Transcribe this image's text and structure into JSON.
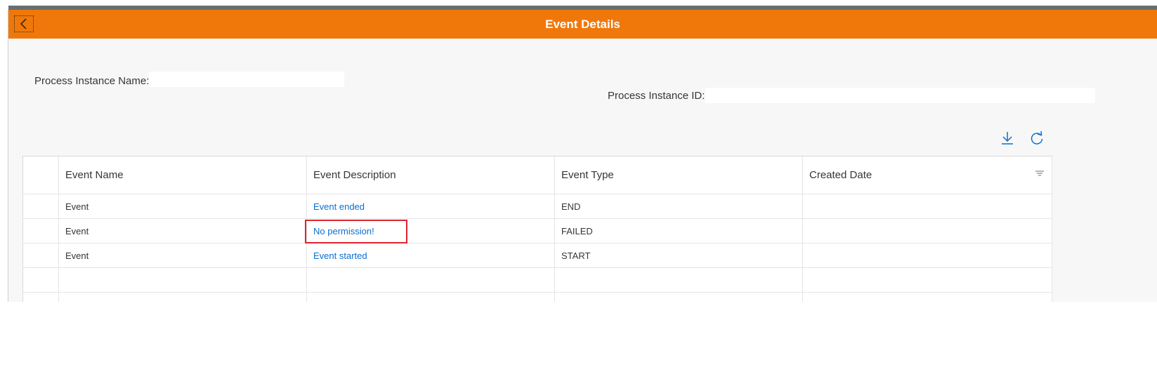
{
  "header": {
    "title": "Event Details",
    "back_icon": "chevron-left-icon"
  },
  "fields": {
    "instance_name_label": "Process Instance Name:",
    "instance_name_value": "",
    "instance_id_label": "Process Instance ID:",
    "instance_id_value": ""
  },
  "toolbar": {
    "download_icon": "download-icon",
    "refresh_icon": "refresh-icon"
  },
  "table": {
    "columns": [
      "Event Name",
      "Event Description",
      "Event Type",
      "Created Date"
    ],
    "rows": [
      {
        "name": "Event",
        "description": "Event ended",
        "type": "END",
        "created": ""
      },
      {
        "name": "Event",
        "description": "No permission!",
        "type": "FAILED",
        "created": ""
      },
      {
        "name": "Event",
        "description": "Event started",
        "type": "START",
        "created": ""
      }
    ],
    "filter_icon": "filter-icon"
  },
  "colors": {
    "header": "#f0780b",
    "link": "#0a6ed1",
    "highlight": "#e0242e"
  }
}
